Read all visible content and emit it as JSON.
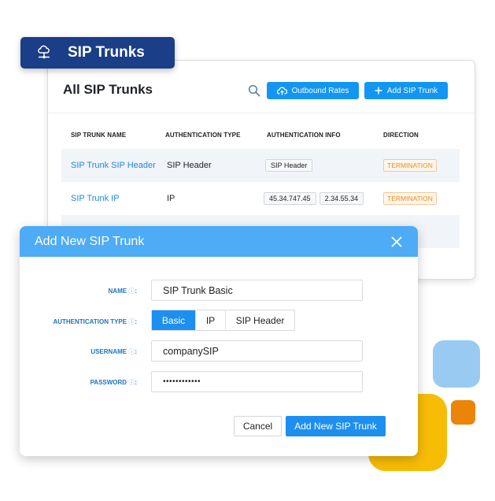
{
  "header": {
    "title": "SIP Trunks",
    "icon": "cloud-network-icon"
  },
  "card": {
    "title": "All SIP Trunks",
    "search_icon": "search-icon",
    "buttons": {
      "outbound_rates": {
        "label": "Outbound Rates",
        "icon": "cloud-upload-icon"
      },
      "add_sip_trunk": {
        "label": "Add SIP Trunk",
        "icon": "plus-icon"
      }
    },
    "table": {
      "columns": [
        "SIP TRUNK NAME",
        "AUTHENTICATION TYPE",
        "AUTHENTICATION INFO",
        "DIRECTION"
      ],
      "rows": [
        {
          "name": "SIP Trunk SIP Header",
          "auth_type": "SIP Header",
          "auth_info": [
            "SIP Header"
          ],
          "direction": "TERMINATION"
        },
        {
          "name": "SIP Trunk IP",
          "auth_type": "IP",
          "auth_info": [
            "45.34.747.45",
            "2.34.55.34"
          ],
          "direction": "TERMINATION"
        }
      ]
    }
  },
  "modal": {
    "title": "Add New SIP Trunk",
    "close_icon": "close-icon",
    "fields": {
      "name": {
        "label": "NAME",
        "value": "SIP Trunk Basic"
      },
      "auth_type": {
        "label": "AUTHENTICATION TYPE",
        "options": [
          "Basic",
          "IP",
          "SIP Header"
        ],
        "selected": "Basic"
      },
      "username": {
        "label": "USERNAME",
        "value": "companySIP"
      },
      "password": {
        "label": "PASSWORD",
        "value": "••••••••••••"
      }
    },
    "info_glyph": "ⓘ",
    "buttons": {
      "cancel": "Cancel",
      "submit": "Add New SIP Trunk"
    }
  },
  "colors": {
    "header_pill": "#1a3e87",
    "primary": "#1396f2",
    "modal_header": "#4eabf5",
    "badge_orange": "#f08a1d",
    "shape_yellow": "#f7bc06",
    "shape_blue": "#99cbf2",
    "shape_orange": "#eb8407"
  }
}
